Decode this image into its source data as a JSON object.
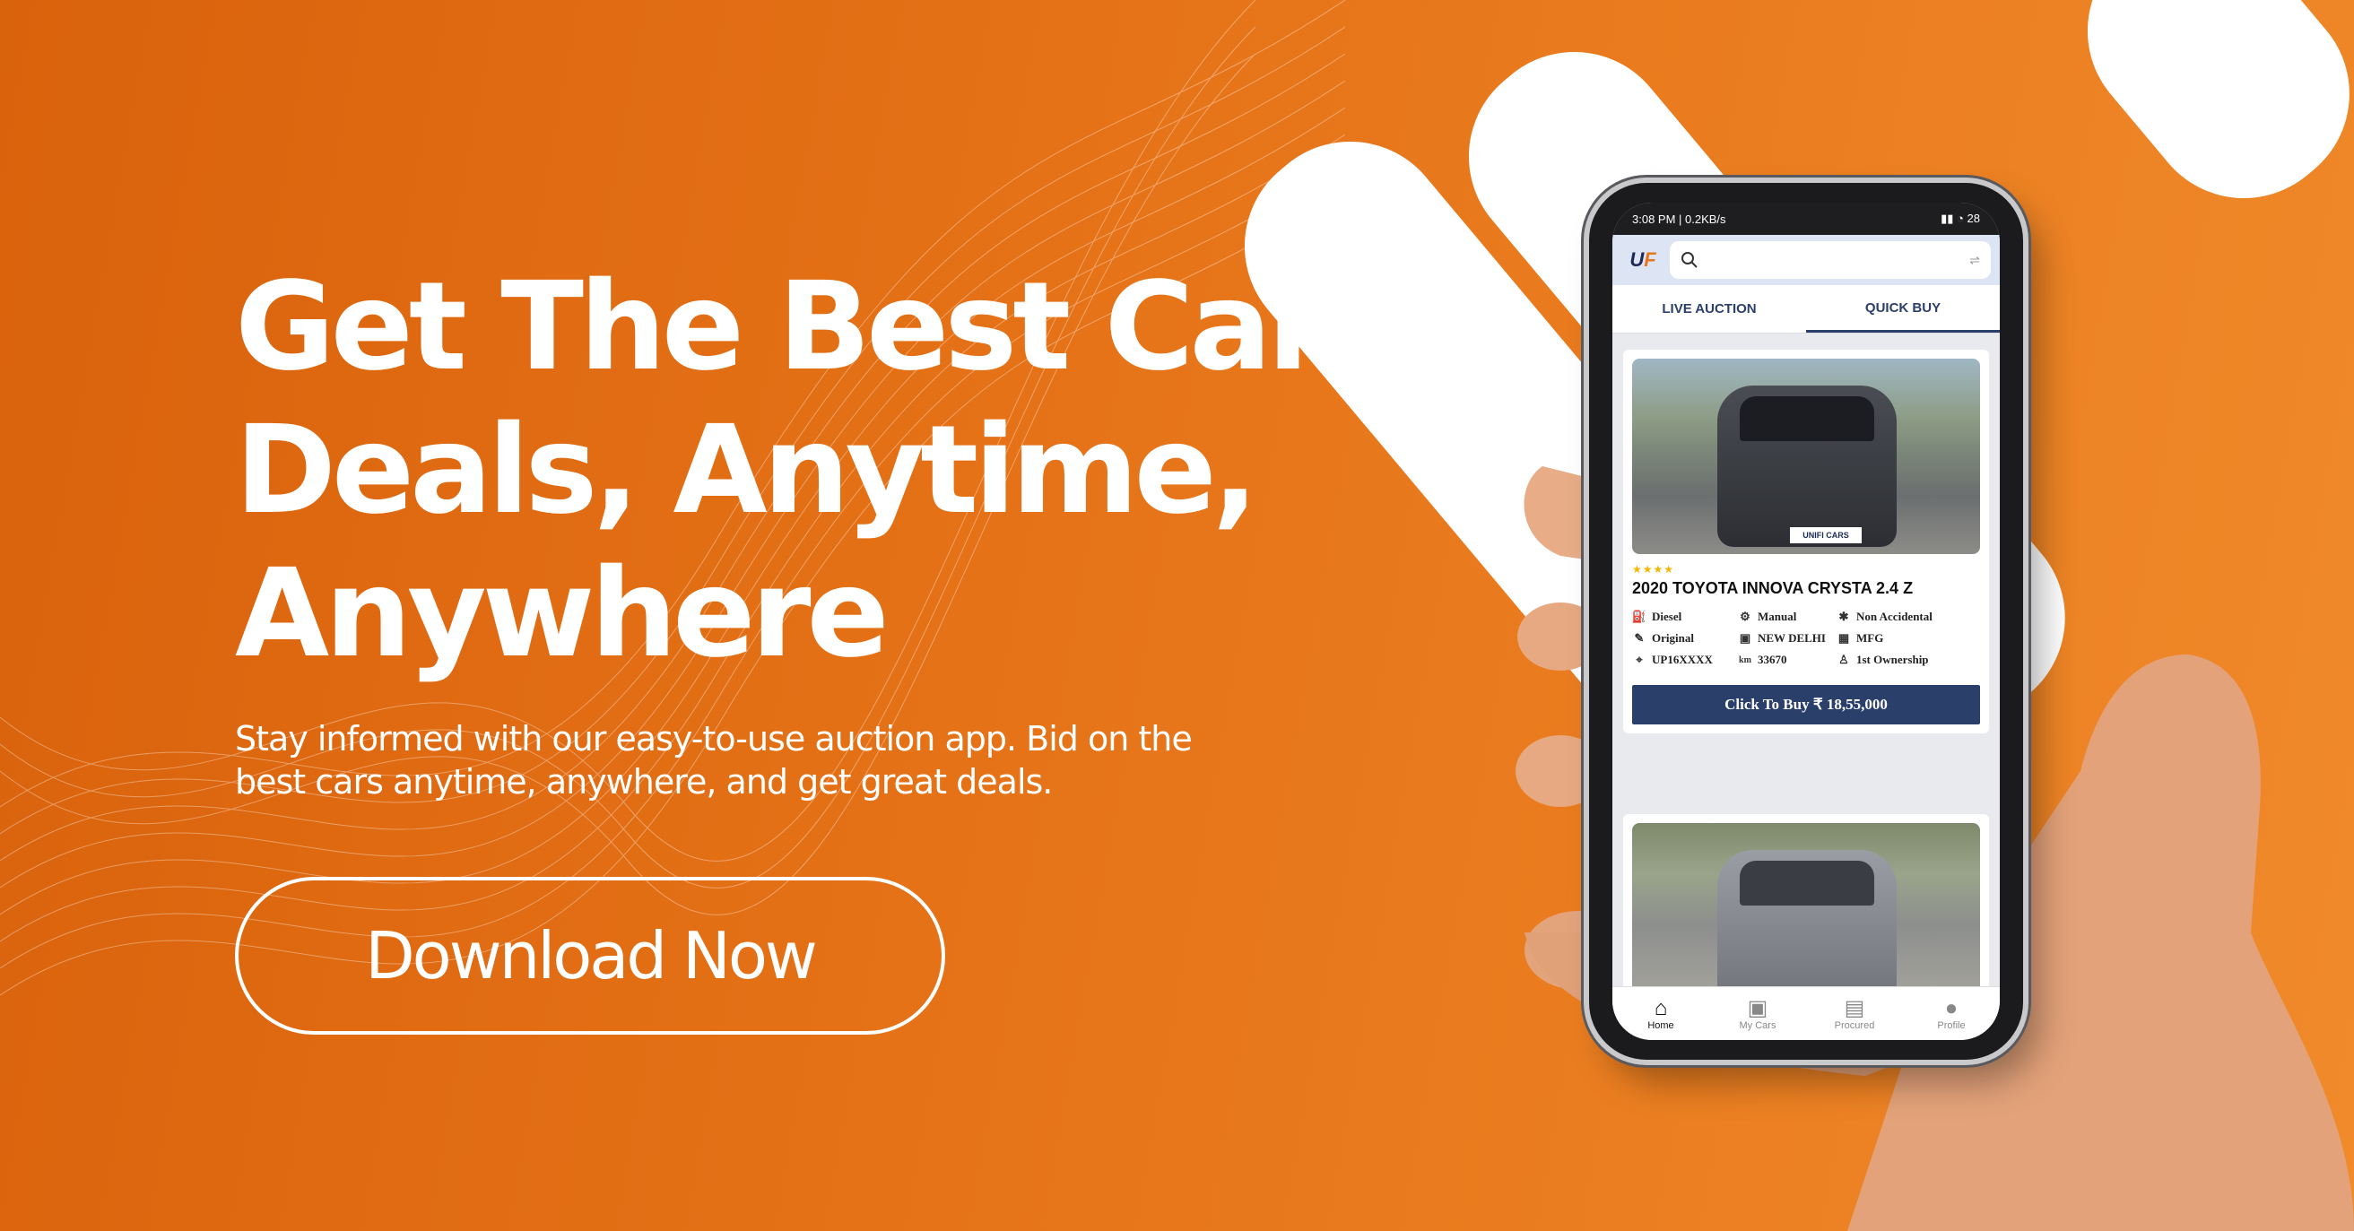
{
  "hero": {
    "headline_1": "Get The Best Car",
    "headline_2": "Deals, Anytime,",
    "headline_3": "Anywhere",
    "subtitle": "Stay informed with our easy-to-use auction app. Bid on the best cars anytime, anywhere, and get great deals.",
    "cta_label": "Download Now"
  },
  "colors": {
    "brand_orange": "#e8761c",
    "navy": "#2b3f6b",
    "white": "#ffffff"
  },
  "app": {
    "status_left": "3:08 PM | 0.2KB/s",
    "status_right": "28",
    "logo": "U",
    "search_icon": "search-icon",
    "tabs": [
      {
        "label": "LIVE AUCTION"
      },
      {
        "label": "QUICK BUY"
      }
    ],
    "active_tab": "QUICK BUY",
    "listing": {
      "rating_stars": 4,
      "stars": "★★★★",
      "title": "2020 TOYOTA INNOVA CRYSTA  2.4 Z",
      "watermark": "UNIFI CARS",
      "specs": [
        {
          "icon": "fuel-icon",
          "label": "Diesel"
        },
        {
          "icon": "gear-shift-icon",
          "label": "Manual"
        },
        {
          "icon": "car-crash-icon",
          "label": "Non Accidental"
        },
        {
          "icon": "paint-icon",
          "label": "Original"
        },
        {
          "icon": "car-icon",
          "label": "NEW DELHI"
        },
        {
          "icon": "calendar-icon",
          "label": "MFG"
        },
        {
          "icon": "location-icon",
          "label": "UP16XXXX"
        },
        {
          "icon": "odometer-icon",
          "label": "33670"
        },
        {
          "icon": "person-icon",
          "label": "1st Ownership"
        }
      ],
      "buy_label": "Click To Buy ₹  18,55,000"
    },
    "bottom_nav": [
      {
        "icon": "home-icon",
        "label": "Home"
      },
      {
        "icon": "car-icon",
        "label": "My Cars"
      },
      {
        "icon": "bag-icon",
        "label": "Procured"
      },
      {
        "icon": "profile-icon",
        "label": "Profile"
      }
    ]
  }
}
